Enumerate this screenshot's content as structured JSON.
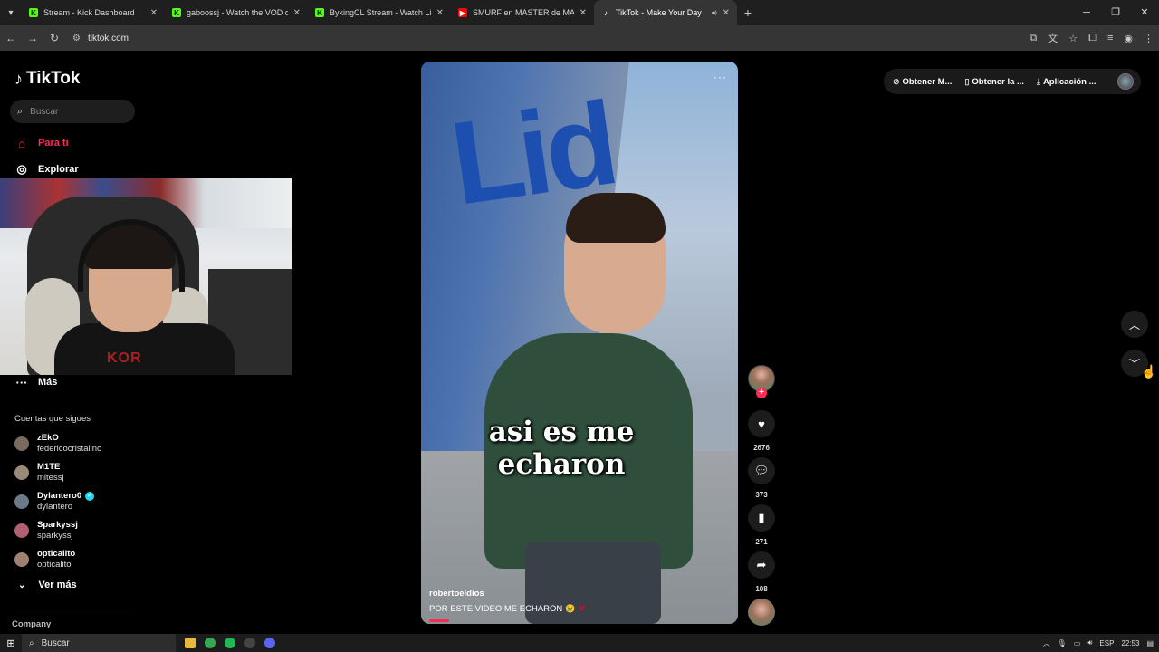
{
  "browser": {
    "tabs": [
      {
        "title": "Stream - Kick Dashboard",
        "favicon": "kick-icon",
        "color": "#53fc18"
      },
      {
        "title": "gaboossj - Watch the VOD on",
        "favicon": "kick-icon",
        "color": "#53fc18"
      },
      {
        "title": "BykingCL Stream - Watch Live",
        "favicon": "kick-icon",
        "color": "#53fc18"
      },
      {
        "title": "SMURF en MASTER de MANUA",
        "favicon": "youtube-icon",
        "color": "#ff0000"
      },
      {
        "title": "TikTok - Make Your Day",
        "favicon": "tiktok-icon",
        "color": "#ffffff"
      }
    ],
    "url": "tiktok.com"
  },
  "sidebar": {
    "logo_text": "TikTok",
    "search_placeholder": "Buscar",
    "nav": {
      "for_you": "Para ti",
      "explore": "Explorar",
      "more": "Más"
    },
    "following_title": "Cuentas que sigues",
    "following": [
      {
        "nick": "zEkO",
        "handle": "federicocristalino",
        "verified": false,
        "color": "#7a6a60"
      },
      {
        "nick": "M1TE",
        "handle": "mitessj",
        "verified": false,
        "color": "#9a8a7a"
      },
      {
        "nick": "Dylantero0",
        "handle": "dylantero",
        "verified": true,
        "color": "#6b7a88"
      },
      {
        "nick": "Sparkyssj",
        "handle": "sparkyssj",
        "verified": false,
        "color": "#b06070"
      },
      {
        "nick": "opticalito",
        "handle": "opticalito",
        "verified": false,
        "color": "#a08070"
      }
    ],
    "see_more": "Ver más",
    "company": "Company"
  },
  "video": {
    "caption": "asi es me echaron",
    "author": "robertoeldios",
    "description": "POR ESTE VIDEO ME ECHARON",
    "progress_fraction": 0.06
  },
  "actions": {
    "likes": "2676",
    "comments": "373",
    "saves": "271",
    "shares": "108"
  },
  "topbar": {
    "coins": "Obtener M...",
    "app": "Obtener la ...",
    "desktop": "Aplicación ..."
  },
  "taskbar": {
    "search": "Buscar",
    "lang": "ESP",
    "time": "22:53"
  },
  "colors": {
    "accent": "#fe2c55",
    "verified": "#20d5ec"
  }
}
